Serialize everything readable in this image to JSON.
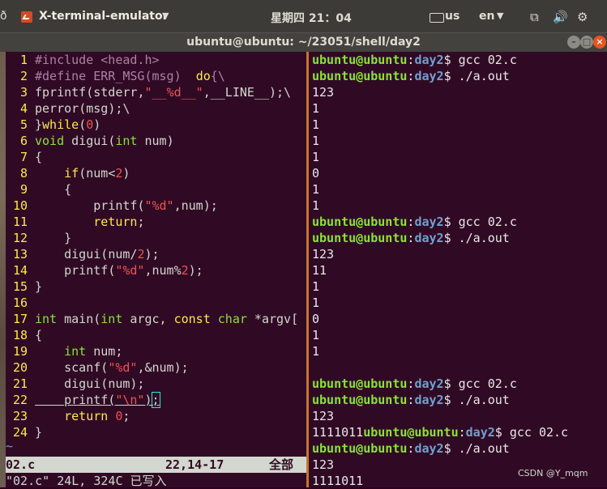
{
  "topbar": {
    "left_stub": "ð",
    "app_name": "X-terminal-emulator",
    "clock": "星期四 21：04",
    "ime": "us",
    "lang": "en"
  },
  "window": {
    "title": "ubuntu@ubuntu: ~/23051/shell/day2"
  },
  "vim": {
    "lines": [
      {
        "n": "1",
        "t": "#include <head.h>"
      },
      {
        "n": "2",
        "t": "#define ERR_MSG(msg)  do{\\"
      },
      {
        "n": "3",
        "t": "fprintf(stderr,\"__%d__\",__LINE__);\\"
      },
      {
        "n": "4",
        "t": "perror(msg);\\"
      },
      {
        "n": "5",
        "t": "}while(0)"
      },
      {
        "n": "6",
        "t": "void digui(int num)"
      },
      {
        "n": "7",
        "t": "{"
      },
      {
        "n": "8",
        "t": "    if(num<2)"
      },
      {
        "n": "9",
        "t": "    {"
      },
      {
        "n": "10",
        "t": "        printf(\"%d\",num);"
      },
      {
        "n": "11",
        "t": "        return;"
      },
      {
        "n": "12",
        "t": "    }"
      },
      {
        "n": "13",
        "t": "    digui(num/2);"
      },
      {
        "n": "14",
        "t": "    printf(\"%d\",num%2);"
      },
      {
        "n": "15",
        "t": "}"
      },
      {
        "n": "16",
        "t": ""
      },
      {
        "n": "17",
        "t": "int main(int argc, const char *argv["
      },
      {
        "n": "18",
        "t": "{"
      },
      {
        "n": "19",
        "t": "    int num;"
      },
      {
        "n": "20",
        "t": "    scanf(\"%d\",&num);"
      },
      {
        "n": "21",
        "t": "    digui(num);"
      },
      {
        "n": "22",
        "t": "    printf(\"\\n\");"
      },
      {
        "n": "23",
        "t": "    return 0;"
      },
      {
        "n": "24",
        "t": "}"
      }
    ],
    "tilde": "~",
    "status_file": "02.c",
    "status_pos": "22,14-17",
    "status_scroll": "全部",
    "message": "\"02.c\" 24L, 324C 已写入"
  },
  "shell": {
    "user_host": "ubuntu@ubuntu",
    "dir": "day2",
    "lines": [
      {
        "p": 1,
        "cmd": " gcc 02.c"
      },
      {
        "p": 1,
        "cmd": " ./a.out"
      },
      {
        "p": 0,
        "t": "123"
      },
      {
        "p": 0,
        "t": "1"
      },
      {
        "p": 0,
        "t": "1"
      },
      {
        "p": 0,
        "t": "1"
      },
      {
        "p": 0,
        "t": "1"
      },
      {
        "p": 0,
        "t": "0"
      },
      {
        "p": 0,
        "t": "1"
      },
      {
        "p": 0,
        "t": "1"
      },
      {
        "p": 1,
        "cmd": " gcc 02.c"
      },
      {
        "p": 1,
        "cmd": " ./a.out"
      },
      {
        "p": 0,
        "t": "123"
      },
      {
        "p": 0,
        "t": "11"
      },
      {
        "p": 0,
        "t": "1"
      },
      {
        "p": 0,
        "t": "1"
      },
      {
        "p": 0,
        "t": "0"
      },
      {
        "p": 0,
        "t": "1"
      },
      {
        "p": 0,
        "t": "1"
      },
      {
        "p": 0,
        "t": ""
      },
      {
        "p": 1,
        "cmd": " gcc 02.c"
      },
      {
        "p": 1,
        "cmd": " ./a.out"
      },
      {
        "p": 0,
        "t": "123"
      },
      {
        "p": 1,
        "pre": "1111011",
        "cmd": " gcc 02.c"
      },
      {
        "p": 1,
        "cmd": " ./a.out"
      },
      {
        "p": 0,
        "t": "123"
      },
      {
        "p": 0,
        "t": "1111011"
      },
      {
        "p": 1,
        "cmd": " ",
        "cursor": true
      }
    ]
  },
  "watermark": "CSDN @Y_mqm"
}
